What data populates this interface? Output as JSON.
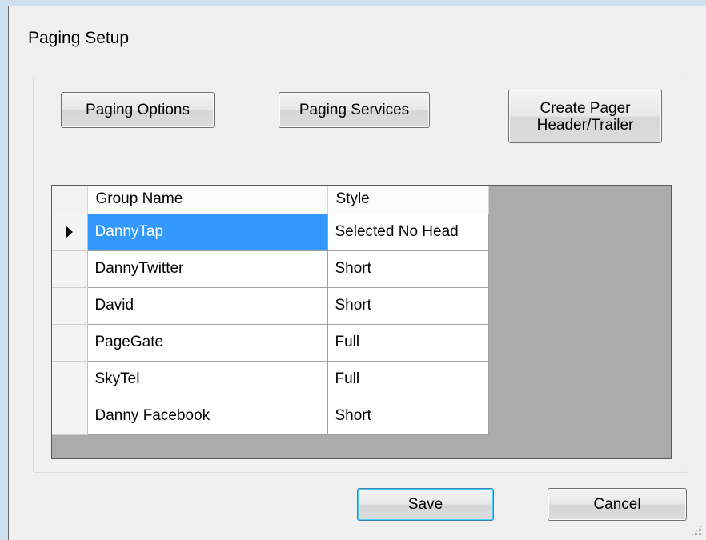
{
  "window": {
    "title": "Paging Setup"
  },
  "buttons": {
    "paging_options": "Paging Options",
    "paging_services": "Paging Services",
    "create_pager_line1": "Create Pager",
    "create_pager_line2": "Header/Trailer",
    "save": "Save",
    "cancel": "Cancel"
  },
  "grid": {
    "columns": [
      "Group Name",
      "Style"
    ],
    "rows": [
      {
        "name": "DannyTap",
        "style": "Selected No Head",
        "selected": true
      },
      {
        "name": "DannyTwitter",
        "style": "Short"
      },
      {
        "name": "David",
        "style": "Short"
      },
      {
        "name": "PageGate",
        "style": "Full"
      },
      {
        "name": "SkyTel",
        "style": "Full"
      },
      {
        "name": "Danny Facebook",
        "style": "Short"
      }
    ]
  },
  "colors": {
    "selection": "#3399ff",
    "grid_background": "#ababab",
    "dialog_background": "#f0f0f0"
  },
  "icons": [
    "current-row-arrow-icon",
    "resize-grip-icon"
  ]
}
